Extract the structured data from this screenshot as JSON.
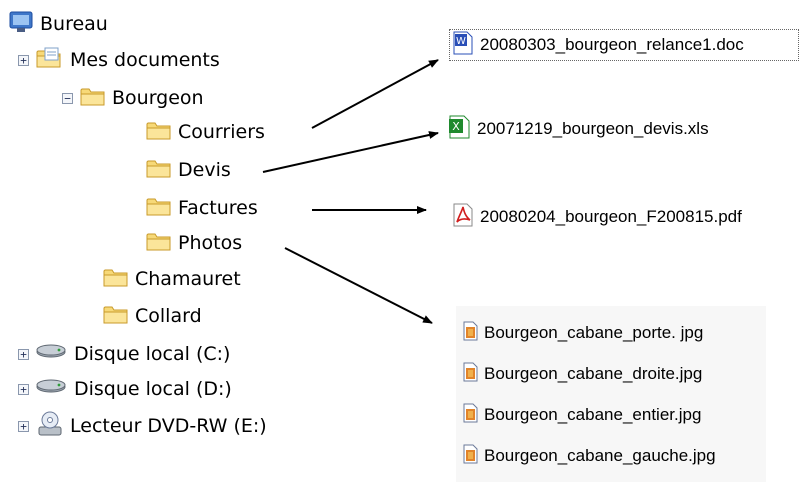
{
  "tree": {
    "desktop": "Bureau",
    "my_documents": "Mes documents",
    "bourgeon": "Bourgeon",
    "courriers": "Courriers",
    "devis": "Devis",
    "factures": "Factures",
    "photos": "Photos",
    "chamauret": "Chamauret",
    "collard": "Collard",
    "disk_c": "Disque local (C:)",
    "disk_d": "Disque local (D:)",
    "dvd": "Lecteur DVD-RW (E:)",
    "expand_symbol": "+",
    "collapse_symbol": "−"
  },
  "files": {
    "doc": "20080303_bourgeon_relance1.doc",
    "xls": "20071219_bourgeon_devis.xls",
    "pdf": "20080204_bourgeon_F200815.pdf",
    "photos": [
      "Bourgeon_cabane_porte. jpg",
      "Bourgeon_cabane_droite.jpg",
      "Bourgeon_cabane_entier.jpg",
      "Bourgeon_cabane_gauche.jpg"
    ]
  },
  "icons": {
    "desktop": "desktop-icon",
    "documents": "documents-folder-icon",
    "folder": "folder-icon",
    "disk": "hard-disk-icon",
    "dvd": "dvd-drive-icon",
    "word": "word-document-icon",
    "excel": "excel-spreadsheet-icon",
    "pdf": "pdf-document-icon",
    "image": "image-file-icon"
  },
  "colors": {
    "folder": "#f5d66e",
    "word_blue": "#2a4fb7",
    "excel_green": "#1f8a2e",
    "pdf_red": "#d11f1f",
    "arrow": "#000000"
  }
}
